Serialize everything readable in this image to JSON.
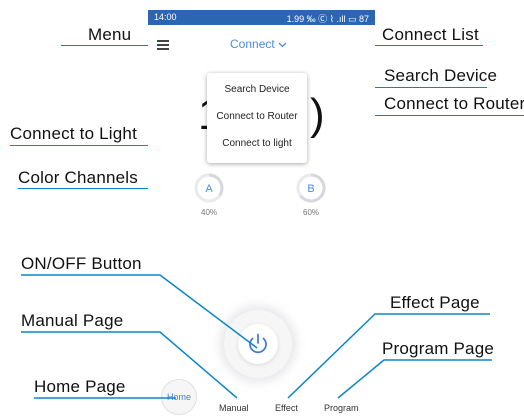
{
  "annotations": {
    "menu": "Menu",
    "connect_list": "Connect List",
    "search_device": "Search Device",
    "connect_to_router": "Connect to Router",
    "connect_to_light": "Connect to Light",
    "color_channels": "Color Channels",
    "on_off_button": "ON/OFF Button",
    "manual_page": "Manual Page",
    "effect_page": "Effect Page",
    "program_page": "Program Page",
    "home_page": "Home Page"
  },
  "status_bar": {
    "time": "14:00",
    "right": "1.99 ‰ Ⓒ ⌇ .ıll ▭ 87"
  },
  "header": {
    "connect_label": "Connect",
    "connect_icon": "chevron-down-icon"
  },
  "popup_menu": {
    "items": [
      "Search Device",
      "Connect to Router",
      "Connect to light"
    ]
  },
  "big_number": {
    "left": "1",
    "right": ")"
  },
  "channels": [
    {
      "label": "A",
      "percent": "40%"
    },
    {
      "label": "B",
      "percent": "60%"
    }
  ],
  "bottom_tabs": {
    "home": "Home",
    "manual": "Manual",
    "effect": "Effect",
    "program": "Program"
  },
  "colors": {
    "accent": "#4a90d9",
    "annotation_line": "#0a86c8",
    "status_bar": "#2a66b1"
  }
}
